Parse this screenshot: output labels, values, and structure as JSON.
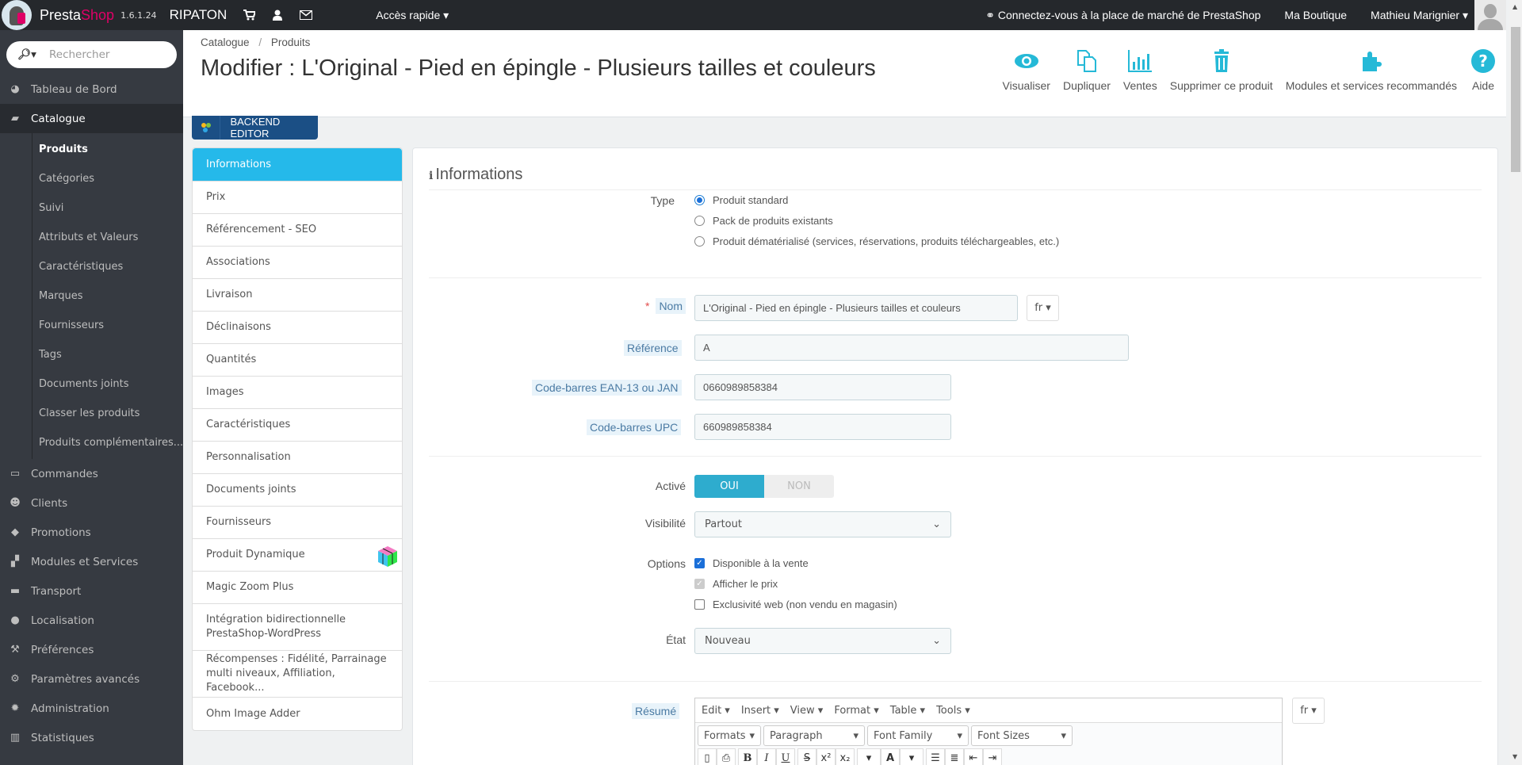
{
  "topbar": {
    "brand_presta": "Presta",
    "brand_shop": "Shop",
    "version": "1.6.1.24",
    "shop_name": "RIPATON",
    "icons": [
      "cart-icon",
      "user-icon",
      "envelope-icon"
    ],
    "quick_access": "Accès rapide ▾",
    "marketplace": "Connectez-vous à la place de marché de PrestaShop",
    "my_shop": "Ma Boutique",
    "user": "Mathieu Marignier ▾"
  },
  "sidebar": {
    "search_placeholder": "Rechercher",
    "items": [
      {
        "label": "Tableau de Bord",
        "icon": "dashboard-icon"
      },
      {
        "label": "Catalogue",
        "icon": "book-icon",
        "active": true
      },
      {
        "label": "Commandes",
        "icon": "credit-card-icon"
      },
      {
        "label": "Clients",
        "icon": "users-icon"
      },
      {
        "label": "Promotions",
        "icon": "tag-icon"
      },
      {
        "label": "Modules et Services",
        "icon": "puzzle-icon"
      },
      {
        "label": "Transport",
        "icon": "truck-icon"
      },
      {
        "label": "Localisation",
        "icon": "globe-icon"
      },
      {
        "label": "Préférences",
        "icon": "wrench-icon"
      },
      {
        "label": "Paramètres avancés",
        "icon": "cogs-icon"
      },
      {
        "label": "Administration",
        "icon": "gear-icon"
      },
      {
        "label": "Statistiques",
        "icon": "bar-chart-icon"
      }
    ],
    "catalogue_sub": [
      "Produits",
      "Catégories",
      "Suivi",
      "Attributs et Valeurs",
      "Caractéristiques",
      "Marques",
      "Fournisseurs",
      "Tags",
      "Documents joints",
      "Classer les produits",
      "Produits complémentaires..."
    ]
  },
  "header": {
    "breadcrumb": [
      "Catalogue",
      "Produits"
    ],
    "title": "Modifier : L'Original - Pied en épingle - Plusieurs tailles et couleurs",
    "toolbar": [
      "Visualiser",
      "Dupliquer",
      "Ventes",
      "Supprimer ce produit",
      "Modules et services recommandés",
      "Aide"
    ]
  },
  "backend_editor": "BACKEND EDITOR",
  "tabs": [
    "Informations",
    "Prix",
    "Référencement - SEO",
    "Associations",
    "Livraison",
    "Déclinaisons",
    "Quantités",
    "Images",
    "Caractéristiques",
    "Personnalisation",
    "Documents joints",
    "Fournisseurs",
    "Produit Dynamique",
    "Magic Zoom Plus",
    "Intégration bidirectionnelle PrestaShop-WordPress",
    "Récompenses : Fidélité, Parrainage multi niveaux, Affiliation, Facebook...",
    "Ohm Image Adder"
  ],
  "form": {
    "heading": "Informations",
    "type_label": "Type",
    "type_options": [
      {
        "label": "Produit standard",
        "checked": true
      },
      {
        "label": "Pack de produits existants",
        "checked": false
      },
      {
        "label": "Produit dématérialisé (services, réservations, produits téléchargeables, etc.)",
        "checked": false
      }
    ],
    "name_label": "Nom",
    "name_required": "*",
    "name_value": "L'Original - Pied en épingle - Plusieurs tailles et couleurs",
    "lang": "fr ▾",
    "reference_label": "Référence",
    "reference_value": "A",
    "ean_label": "Code-barres EAN-13 ou JAN",
    "ean_value": "0660989858384",
    "upc_label": "Code-barres UPC",
    "upc_value": "660989858384",
    "active_label": "Activé",
    "active_yes": "OUI",
    "active_no": "NON",
    "active_value": true,
    "visibility_label": "Visibilité",
    "visibility_value": "Partout",
    "options_label": "Options",
    "options": [
      {
        "label": "Disponible à la vente",
        "checked": true,
        "disabled": false
      },
      {
        "label": "Afficher le prix",
        "checked": true,
        "disabled": true
      },
      {
        "label": "Exclusivité web (non vendu en magasin)",
        "checked": false,
        "disabled": false
      }
    ],
    "condition_label": "État",
    "condition_value": "Nouveau",
    "summary_label": "Résumé",
    "summary_lang": "fr ▾"
  },
  "editor": {
    "menu": [
      "Edit ▾",
      "Insert ▾",
      "View ▾",
      "Format ▾",
      "Table ▾",
      "Tools ▾"
    ],
    "formats": "Formats",
    "paragraph": "Paragraph",
    "font_family": "Font Family",
    "font_sizes": "Font Sizes",
    "buttons": [
      "new-document",
      "print",
      "bold",
      "italic",
      "underline",
      "strikethrough",
      "superscript",
      "subscript",
      "text-color",
      "background-color",
      "bullet-list",
      "numbered-list",
      "outdent",
      "indent"
    ]
  }
}
